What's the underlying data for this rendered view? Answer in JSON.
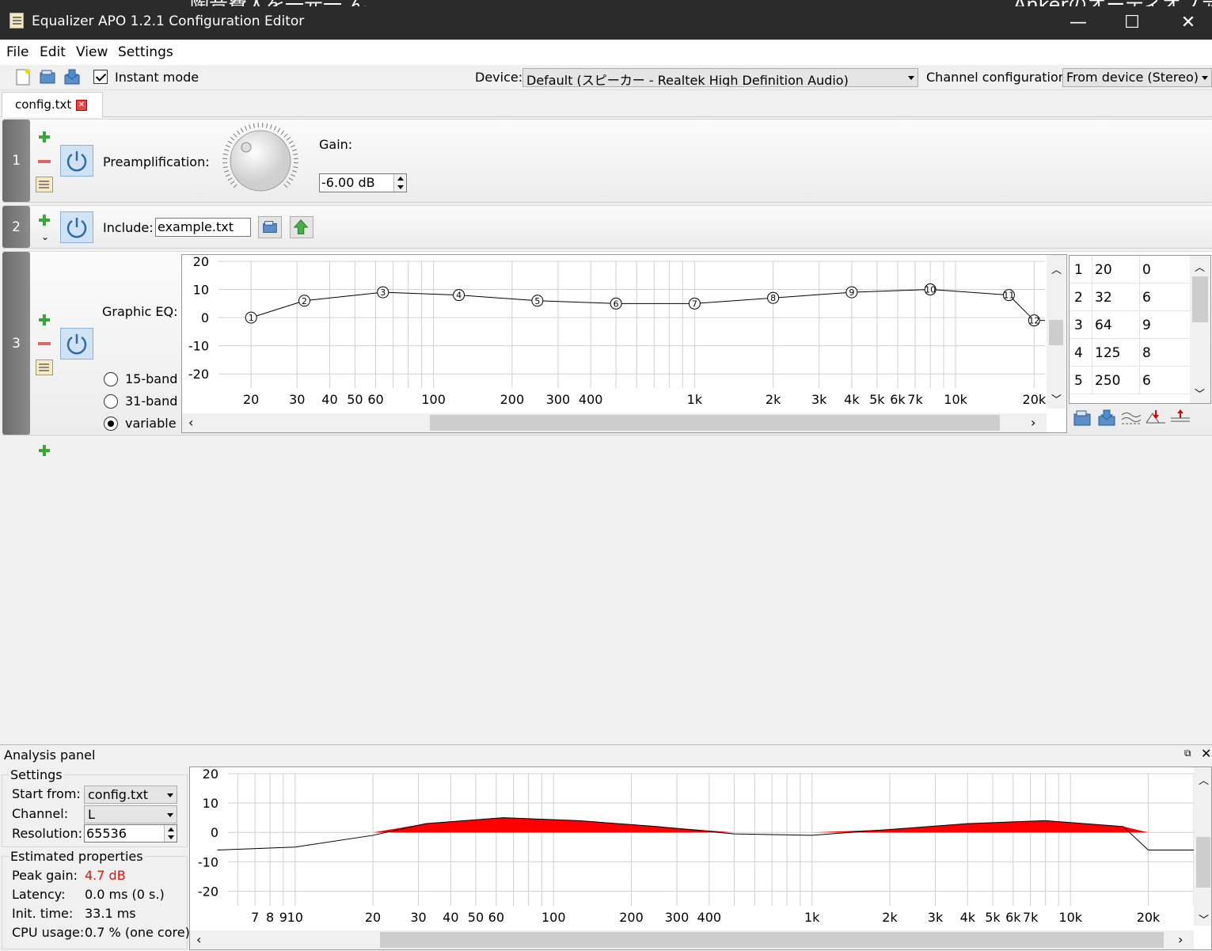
{
  "window": {
    "title": "Equalizer APO 1.2.1 Configuration Editor",
    "background_text_left": "陶音費人を一元一 ん",
    "background_text_right": "Ankerのオーディオファ"
  },
  "menu": [
    "File",
    "Edit",
    "View",
    "Settings"
  ],
  "toolbar": {
    "instant_mode_label": "Instant mode",
    "instant_mode_checked": true,
    "device_label": "Device:",
    "device_value": "Default (スピーカー - Realtek High Definition Audio)",
    "channel_config_label": "Channel configuration:",
    "channel_config_value": "From device (Stereo)"
  },
  "tabs": [
    {
      "label": "config.txt"
    }
  ],
  "filters": {
    "f1": {
      "index": "1",
      "label": "Preamplification:",
      "gain_label": "Gain:",
      "gain_value": "-6.00 dB"
    },
    "f2": {
      "index": "2",
      "label": "Include:",
      "file_value": "example.txt"
    },
    "f3": {
      "index": "3",
      "label": "Graphic EQ:",
      "mode_options": [
        "15-band",
        "31-band",
        "variable"
      ],
      "mode_selected": "variable",
      "eq_bands": [
        {
          "n": "1",
          "freq": "20",
          "gain": "0"
        },
        {
          "n": "2",
          "freq": "32",
          "gain": "6"
        },
        {
          "n": "3",
          "freq": "64",
          "gain": "9"
        },
        {
          "n": "4",
          "freq": "125",
          "gain": "8"
        },
        {
          "n": "5",
          "freq": "250",
          "gain": "6"
        }
      ]
    }
  },
  "chart_data": [
    {
      "type": "line",
      "title": "",
      "x_scale": "log",
      "x": [
        20,
        32,
        64,
        125,
        250,
        500,
        1000,
        2000,
        4000,
        8000,
        16000,
        20000
      ],
      "series": [
        {
          "values": [
            0,
            6,
            9,
            8,
            6,
            5,
            5,
            7,
            9,
            10,
            8,
            -1
          ]
        }
      ],
      "point_labels": [
        "1",
        "2",
        "3",
        "4",
        "5",
        "6",
        "7",
        "8",
        "9",
        "10",
        "11",
        "12"
      ],
      "xlim": [
        15,
        22000
      ],
      "ylim": [
        -25,
        20
      ],
      "y_ticks": [
        "20",
        "10",
        "0",
        "-10",
        "-20"
      ],
      "x_tick_labels": [
        "20",
        "30",
        "40",
        "50",
        "60",
        "100",
        "200",
        "300",
        "400",
        "1k",
        "2k",
        "3k",
        "4k",
        "5k",
        "6k",
        "7k",
        "10k",
        "20k"
      ],
      "grid": true
    },
    {
      "type": "area",
      "title": "",
      "x_scale": "log",
      "x": [
        5,
        10,
        20,
        32,
        64,
        125,
        250,
        500,
        1000,
        2000,
        4000,
        8000,
        16000,
        20000,
        30000
      ],
      "series": [
        {
          "values": [
            -6,
            -5,
            -1,
            3,
            5,
            4,
            2,
            -0.5,
            -1,
            1,
            3,
            4,
            2,
            -6,
            -6
          ]
        }
      ],
      "xlim": [
        5.5,
        30000
      ],
      "ylim": [
        -25,
        20
      ],
      "y_ticks": [
        "20",
        "10",
        "0",
        "-10",
        "-20"
      ],
      "x_tick_labels": [
        "7",
        "8",
        "9",
        "10",
        "20",
        "30",
        "40",
        "50",
        "60",
        "100",
        "200",
        "300",
        "400",
        "1k",
        "2k",
        "3k",
        "4k",
        "5k",
        "6k",
        "7k",
        "10k",
        "20k"
      ],
      "grid": true
    }
  ],
  "analysis": {
    "panel_title": "Analysis panel",
    "settings_title": "Settings",
    "start_from_label": "Start from:",
    "start_from_value": "config.txt",
    "channel_label": "Channel:",
    "channel_value": "L",
    "resolution_label": "Resolution:",
    "resolution_value": "65536",
    "estimated_title": "Estimated properties",
    "peak_gain_label": "Peak gain:",
    "peak_gain_value": "4.7 dB",
    "latency_label": "Latency:",
    "latency_value": "0.0 ms (0 s.)",
    "init_time_label": "Init. time:",
    "init_time_value": "33.1 ms",
    "cpu_label": "CPU usage:",
    "cpu_value": "0.7 % (one core)"
  },
  "colors": {
    "titlebar": "#2b2b2b",
    "gain_fill": "#ff0000",
    "peak_gain_text": "#e01010",
    "power_button": "#cfe3f5"
  }
}
